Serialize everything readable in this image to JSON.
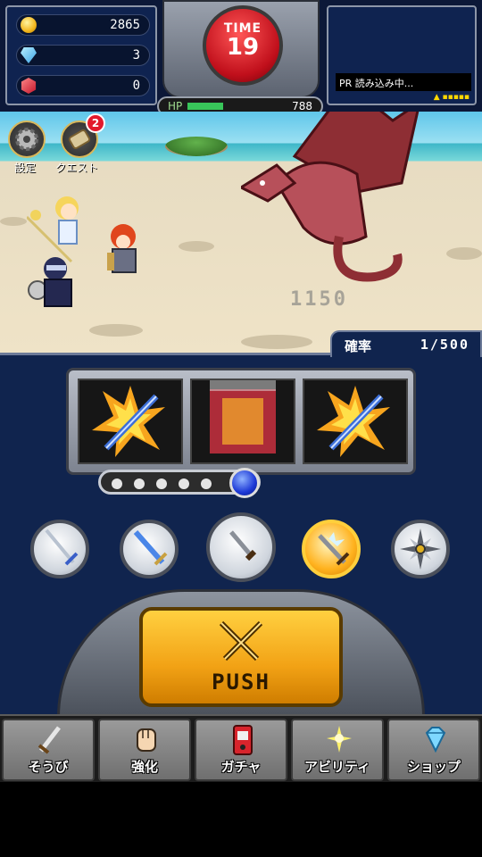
{
  "resources": {
    "coins": "2865",
    "gems": "3",
    "rubies": "0"
  },
  "timer": {
    "label": "TIME",
    "value": "19"
  },
  "ad": {
    "text": "PR 読み込み中..."
  },
  "boss": {
    "hp_label": "HP",
    "hp_value": "788",
    "damage_text": "1150"
  },
  "side_buttons": {
    "settings_label": "設定",
    "quest_label": "クエスト",
    "quest_badge": "2"
  },
  "slot": {
    "rate_label": "確率",
    "rate_value": "1/500",
    "progress_filled": 5,
    "progress_total": 6,
    "reels": [
      "flaming-sword",
      "spinning",
      "flaming-sword"
    ]
  },
  "weapons": [
    {
      "name": "sword",
      "active": false
    },
    {
      "name": "blue-sword",
      "active": false
    },
    {
      "name": "dagger",
      "active": false
    },
    {
      "name": "ice-sword",
      "active": true
    },
    {
      "name": "shuriken",
      "active": false
    }
  ],
  "push": {
    "label": "PUSH"
  },
  "nav": {
    "items": [
      {
        "label": "そうび",
        "icon": "sword-icon"
      },
      {
        "label": "強化",
        "icon": "fist-icon"
      },
      {
        "label": "ガチャ",
        "icon": "gacha-icon"
      },
      {
        "label": "アビリティ",
        "icon": "star-icon"
      },
      {
        "label": "ショップ",
        "icon": "diamond-icon"
      }
    ]
  },
  "colors": {
    "panel_bg": "#10244e",
    "timer_red": "#c00f1b",
    "push_gold": "#f2a215",
    "hp_green": "#38c65a"
  }
}
